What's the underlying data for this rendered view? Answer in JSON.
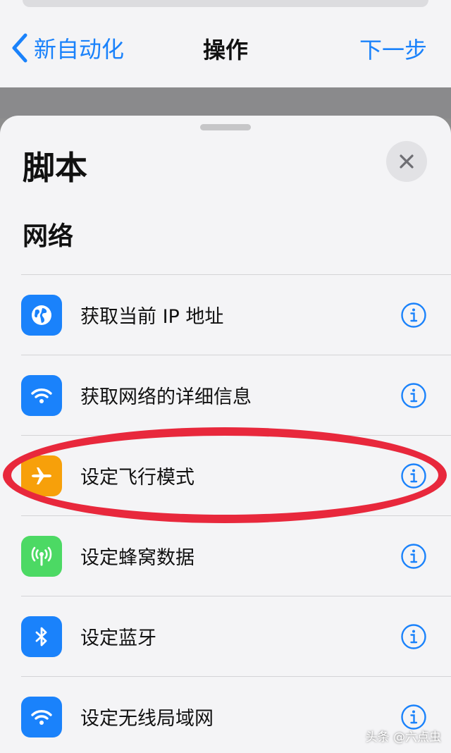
{
  "nav": {
    "back_label": "新自动化",
    "title": "操作",
    "next_label": "下一步"
  },
  "sheet": {
    "title": "脚本",
    "section": "网络"
  },
  "actions": [
    {
      "label": "获取当前 IP 地址",
      "icon": "globe-icon",
      "color": "#1a82fb"
    },
    {
      "label": "获取网络的详细信息",
      "icon": "wifi-icon",
      "color": "#1a82fb"
    },
    {
      "label": "设定飞行模式",
      "icon": "airplane-icon",
      "color": "#f7a00a"
    },
    {
      "label": "设定蜂窝数据",
      "icon": "cellular-antenna-icon",
      "color": "#4cd964"
    },
    {
      "label": "设定蓝牙",
      "icon": "bluetooth-icon",
      "color": "#1a82fb"
    },
    {
      "label": "设定无线局域网",
      "icon": "wifi-icon",
      "color": "#1a82fb"
    }
  ],
  "colors": {
    "accent": "#1a82fb",
    "highlight": "#e8283c"
  },
  "watermark": "头条 @六点虫"
}
